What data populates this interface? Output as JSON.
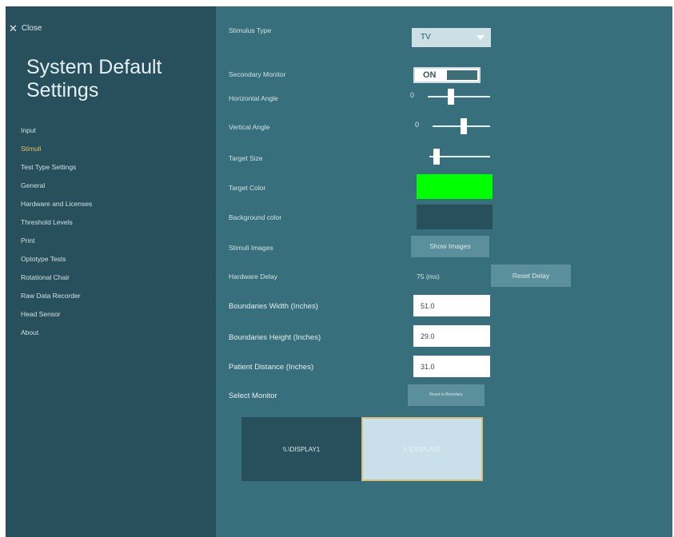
{
  "close_label": "Close",
  "page_title": "System Default Settings",
  "nav_items": [
    {
      "label": "Input",
      "active": false
    },
    {
      "label": "Stimuli",
      "active": true
    },
    {
      "label": "Test Type Settings",
      "active": false
    },
    {
      "label": "General",
      "active": false
    },
    {
      "label": "Hardware and Licenses",
      "active": false
    },
    {
      "label": "Threshold Levels",
      "active": false
    },
    {
      "label": "Print",
      "active": false
    },
    {
      "label": "Optotype Tests",
      "active": false
    },
    {
      "label": "Rotational Chair",
      "active": false
    },
    {
      "label": "Raw Data Recorder",
      "active": false
    },
    {
      "label": "Head Sensor",
      "active": false
    },
    {
      "label": "About",
      "active": false
    }
  ],
  "settings": {
    "stimulus_type": {
      "label": "Stimulus Type",
      "value": "TV"
    },
    "secondary_monitor": {
      "label": "Secondary Monitor",
      "value": "ON"
    },
    "horizontal_angle": {
      "label": "Horizontal Angle",
      "min_label": "0",
      "level": 0.35
    },
    "vertical_angle": {
      "label": "Vertical Angle",
      "min_label": "0",
      "level": 0.55
    },
    "target_size": {
      "label": "Target Size",
      "level": 0.08
    },
    "target_color": {
      "label": "Target Color",
      "color": "#00ff00"
    },
    "background_color": {
      "label": "Background color",
      "color": "#27505c"
    },
    "stimuli_images": {
      "label": "Stimuli Images",
      "button": "Show Images"
    },
    "hardware_delay": {
      "label": "Hardware Delay",
      "value": "75 (ms)",
      "button": "Reset Delay"
    },
    "boundaries_width": {
      "label": "Boundaries Width  (Inches)",
      "value": "51.0"
    },
    "boundaries_height": {
      "label": "Boundaries Height  (Inches)",
      "value": "29.0"
    },
    "patient_distance": {
      "label": "Patient Distance  (Inches)",
      "value": "31.0"
    },
    "select_monitor": {
      "label": "Select Monitor",
      "button": "Reset to Boundary"
    }
  },
  "monitors": [
    {
      "name": "\\\\.\\DISPLAY1",
      "selected": false
    },
    {
      "name": "\\\\.\\DISPLAY2",
      "selected": true
    }
  ],
  "colors": {
    "sidebar_bg": "#27505c",
    "content_bg": "#386f7c",
    "accent": "#e1c35a",
    "monitor_selected": "#c9e0ea",
    "monitor_unselected": "#27505c"
  }
}
